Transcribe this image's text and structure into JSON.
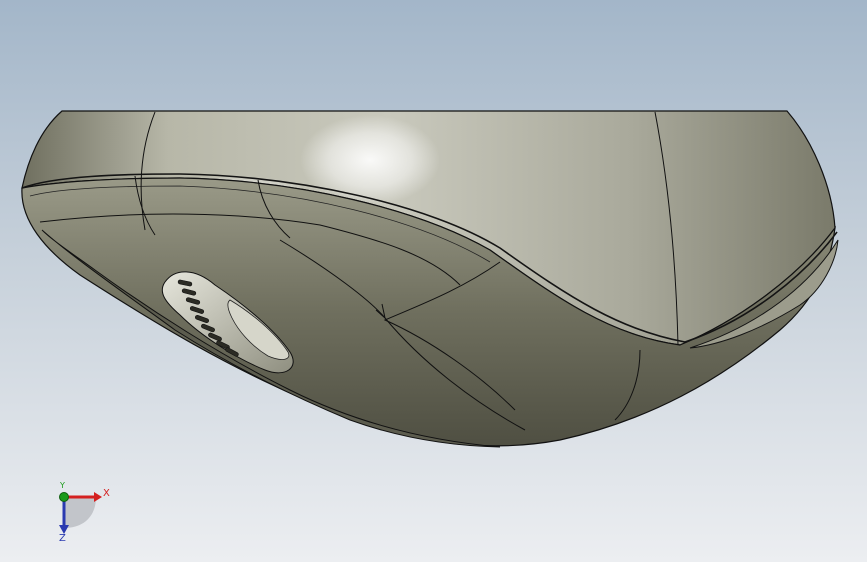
{
  "viewport": {
    "background_top": "#a3b6c9",
    "background_bottom": "#eceef1"
  },
  "model": {
    "surface_color": "#8a8a78",
    "edge_color": "#101010",
    "highlight_color": "#ffffff"
  },
  "triad": {
    "x_label": "X",
    "y_label": "Y",
    "z_label": "Z",
    "x_color": "#d42020",
    "y_color": "#1a9a1a",
    "z_color": "#2a3ab0"
  }
}
